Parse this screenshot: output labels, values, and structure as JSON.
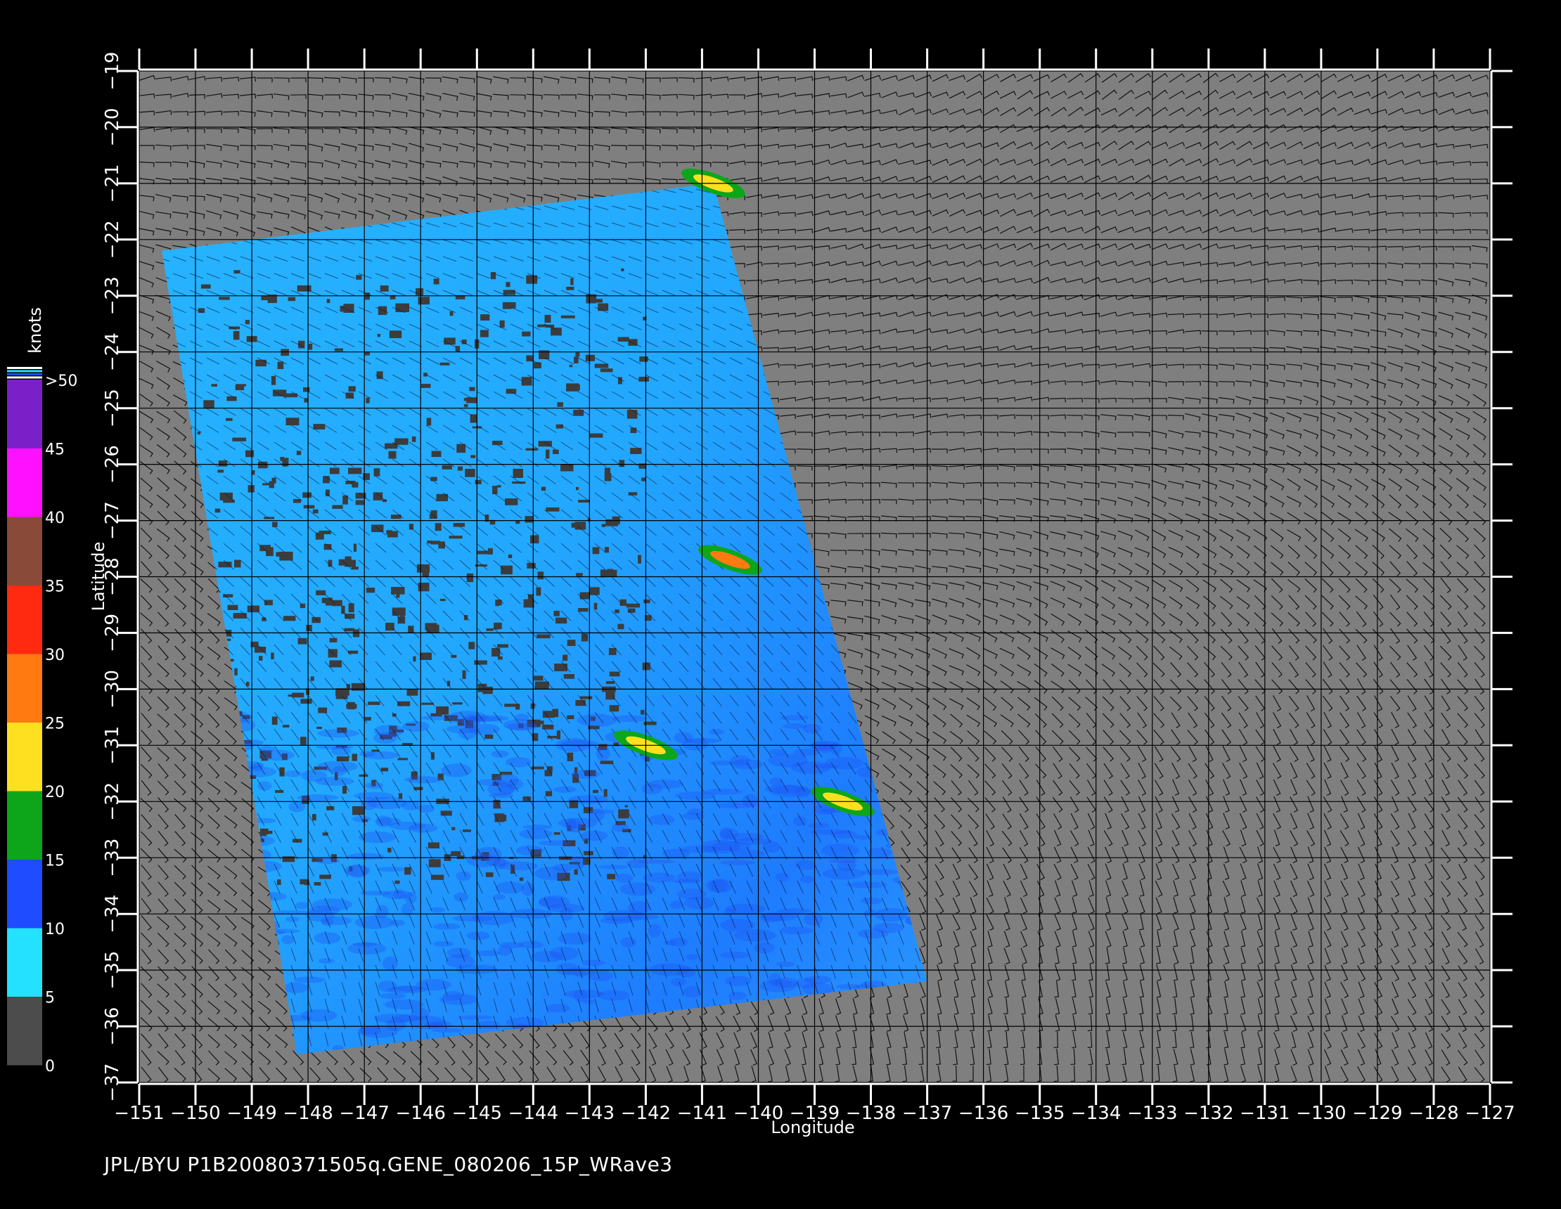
{
  "footer_text": "JPL/BYU  P1B20080371505q.GENE_080206_15P_WRave3",
  "chart_data": {
    "type": "heatmap",
    "title": "",
    "xlabel": "Longitude",
    "ylabel": "Latitude",
    "xlim": [
      -151,
      -127
    ],
    "ylim": [
      -37,
      -19
    ],
    "grid": true,
    "x_ticks": [
      -151,
      -150,
      -149,
      -148,
      -147,
      -146,
      -145,
      -144,
      -143,
      -142,
      -141,
      -140,
      -139,
      -138,
      -137,
      -136,
      -135,
      -134,
      -133,
      -132,
      -131,
      -130,
      -129,
      -128,
      -127
    ],
    "y_ticks": [
      -19,
      -20,
      -21,
      -22,
      -23,
      -24,
      -25,
      -26,
      -27,
      -28,
      -29,
      -30,
      -31,
      -32,
      -33,
      -34,
      -35,
      -36,
      -37
    ],
    "colorbar": {
      "unit_label": "knots",
      "tick_labels": [
        ">50",
        "45",
        "40",
        "35",
        "30",
        "25",
        "20",
        "15",
        "10",
        "5",
        "0"
      ],
      "tick_values": [
        50,
        45,
        40,
        35,
        30,
        25,
        20,
        15,
        10,
        5,
        0
      ],
      "colors": [
        "#4c4c4c",
        "#24e2ff",
        "#1f4cff",
        "#0da61a",
        "#ffe020",
        "#ff7a10",
        "#ff2a10",
        "#8a4a3a",
        "#ff10ff",
        "#7a20c8"
      ],
      "color_ranges": [
        [
          0,
          5
        ],
        [
          5,
          10
        ],
        [
          10,
          15
        ],
        [
          15,
          20
        ],
        [
          20,
          25
        ],
        [
          25,
          30
        ],
        [
          30,
          35
        ],
        [
          35,
          40
        ],
        [
          40,
          45
        ],
        [
          45,
          50
        ]
      ]
    },
    "swath_corners": [
      [
        -150.6,
        -22.2
      ],
      [
        -140.8,
        -21.0
      ],
      [
        -137.0,
        -35.2
      ],
      [
        -148.2,
        -36.5
      ]
    ],
    "wind_field_color": "#7f7f7f",
    "no_data_color": "#3c3c3c",
    "high_wind_bands": [
      {
        "lon": -140.5,
        "lat": -27.7,
        "speed": 25
      },
      {
        "lon": -142.0,
        "lat": -31.0,
        "speed": 20
      },
      {
        "lon": -138.5,
        "lat": -32.0,
        "speed": 20
      },
      {
        "lon": -140.8,
        "lat": -21.0,
        "speed": 20
      }
    ]
  }
}
